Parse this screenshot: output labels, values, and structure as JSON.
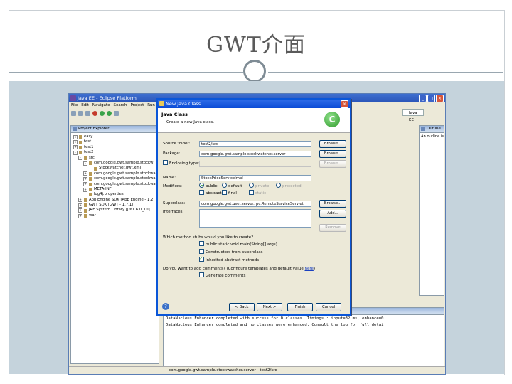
{
  "slide": {
    "title": "GWT介面"
  },
  "eclipse": {
    "window_title": "Java EE - Eclipse Platform",
    "menu": [
      "File",
      "Edit",
      "Navigate",
      "Search",
      "Project",
      "Run"
    ],
    "perspective_label": "Java EE",
    "project_explorer": {
      "tab": "Project Explorer",
      "items": [
        {
          "text": "easy",
          "indent": 0,
          "toggle": "+"
        },
        {
          "text": "test",
          "indent": 0,
          "toggle": "+"
        },
        {
          "text": "test1",
          "indent": 0,
          "toggle": "+"
        },
        {
          "text": "test2",
          "indent": 0,
          "toggle": "-"
        },
        {
          "text": "src",
          "indent": 1,
          "toggle": "-"
        },
        {
          "text": "com.google.gwt.sample.stockw",
          "indent": 2,
          "toggle": "-"
        },
        {
          "text": "StockWatcher.gwt.xml",
          "indent": 3,
          "toggle": ""
        },
        {
          "text": "com.google.gwt.sample.stockwa",
          "indent": 2,
          "toggle": "+"
        },
        {
          "text": "com.google.gwt.sample.stockwa",
          "indent": 2,
          "toggle": "+"
        },
        {
          "text": "com.google.gwt.sample.stockwa",
          "indent": 2,
          "toggle": "+"
        },
        {
          "text": "META-INF",
          "indent": 2,
          "toggle": "+"
        },
        {
          "text": "log4j.properties",
          "indent": 2,
          "toggle": ""
        },
        {
          "text": "App Engine SDK [App Engine - 1.2",
          "indent": 1,
          "toggle": "+"
        },
        {
          "text": "GWT SDK [GWT - 1.7.1]",
          "indent": 1,
          "toggle": "+"
        },
        {
          "text": "JRE System Library [jre1.6.0_10]",
          "indent": 1,
          "toggle": "+"
        },
        {
          "text": "war",
          "indent": 1,
          "toggle": "+"
        }
      ]
    },
    "outline": {
      "tab": "Outline",
      "message": "An outline is not available."
    },
    "console": {
      "lines": [
        "DataNucleus Enhancer completed with success for 0 classes. Timings : input=32 ms, enhance=0",
        "DataNucleus Enhancer completed and no classes were enhanced. Consult the log for full detai"
      ]
    },
    "status_text": "com.google.gwt.sample.stockwatcher.server - test2/src"
  },
  "dialog": {
    "window_title": "New Java Class",
    "header_title": "Java Class",
    "header_subtitle": "Create a new Java class.",
    "labels": {
      "source_folder": "Source folder:",
      "package": "Package:",
      "enclosing_type": "Enclosing type:",
      "name": "Name:",
      "modifiers": "Modifiers:",
      "superclass": "Superclass:",
      "interfaces": "Interfaces:"
    },
    "values": {
      "source_folder": "test2/src",
      "package": "com.google.gwt.sample.stockwatcher.server",
      "enclosing_type": "",
      "name": "StockPriceServiceImpl",
      "superclass": "com.google.gwt.user.server.rpc.RemoteServiceServlet"
    },
    "buttons": {
      "browse": "Browse...",
      "add": "Add...",
      "remove": "Remove",
      "back": "< Back",
      "next": "Next >",
      "finish": "Finish",
      "cancel": "Cancel"
    },
    "modifiers": {
      "public": "public",
      "default": "default",
      "private": "private",
      "protected": "protected",
      "abstract": "abstract",
      "final": "final",
      "static": "static"
    },
    "stubs_question": "Which method stubs would you like to create?",
    "stubs": [
      {
        "label": "public static void main(String[] args)",
        "checked": false
      },
      {
        "label": "Constructors from superclass",
        "checked": false
      },
      {
        "label": "Inherited abstract methods",
        "checked": true
      }
    ],
    "comments_question": "Do you want to add comments? (Configure templates and default value ",
    "comments_link": "here",
    "comments_question_end": ")",
    "generate_comments": "Generate comments"
  },
  "colors": {
    "accent_titlebar": "#0b4bd6",
    "band": "#c5d3dc",
    "class_badge": "#2f9a2c"
  }
}
